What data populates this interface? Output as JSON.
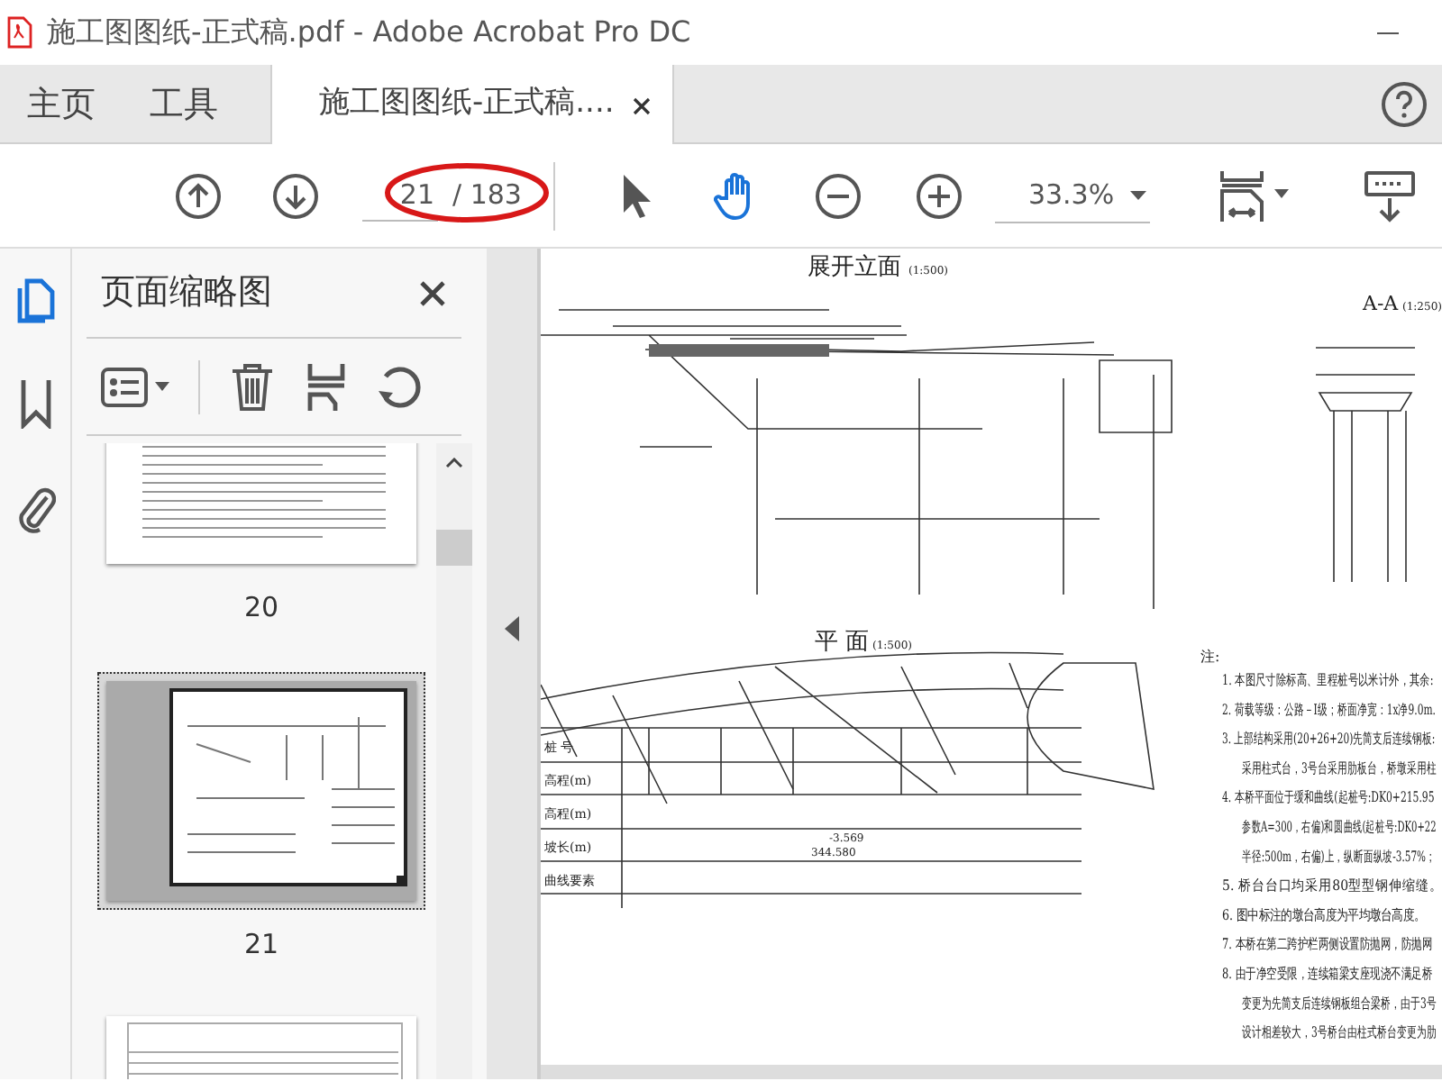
{
  "window": {
    "title": "施工图图纸-正式稿.pdf - Adobe Acrobat Pro DC"
  },
  "tabs": [
    {
      "label": "主页",
      "selected": false,
      "closable": false
    },
    {
      "label": "工具",
      "selected": false,
      "closable": false
    },
    {
      "label": "施工图图纸-正式稿....",
      "selected": true,
      "closable": true
    }
  ],
  "toolbar": {
    "page_input": "21",
    "page_total": "/ 183",
    "zoom": "33.3%",
    "tools": [
      {
        "kind": "select",
        "selected": false
      },
      {
        "kind": "hand",
        "selected": true
      }
    ]
  },
  "sidebar": {
    "items": [
      {
        "kind": "pages",
        "selected": true
      },
      {
        "kind": "bookmarks",
        "selected": false
      },
      {
        "kind": "attachments",
        "selected": false
      }
    ]
  },
  "thumbnail_panel": {
    "title": "页面缩略图",
    "thumbnails": [
      {
        "kind": "text",
        "page": "20",
        "selected": false
      },
      {
        "kind": "drawing",
        "page": "21",
        "selected": true
      },
      {
        "kind": "table",
        "selected": false
      }
    ]
  },
  "document": {
    "elevation_title": "展开立面",
    "elevation_scale": "(1:500)",
    "section_title": "A-A",
    "section_scale": "(1:250)",
    "plan_title": "平  面",
    "plan_scale": "(1:500)",
    "notes_title": "注:",
    "notes": [
      "1. 本图尺寸除标高、里程桩号以米计外，其余:",
      "2. 荷载等级：公路－Ⅰ级；桥面净宽：1x净9.0m.",
      "3. 上部结构采用(20+26+20)先简支后连续钢板:",
      "采用柱式台，3号台采用肋板台，桥墩采用柱",
      "4. 本桥平面位于缓和曲线(起桩号:DK0+215.95",
      "参数A=300，右偏)和圆曲线(起桩号:DK0+22",
      "半径:500m，右偏)上，纵断面纵坡-3.57%；",
      "5. 桥台台口均采用80型型钢伸缩缝。",
      "6. 图中标注的墩台高度为平均墩台高度。",
      "7. 本桥在第二跨护栏两侧设置防抛网，防抛网",
      "8. 由于净空受限，连续箱梁支座现浇不满足桥",
      "变更为先简支后连续钢板组合梁桥，由于3号",
      "设计相差较大，3号桥台由柱式桥台变更为肋"
    ],
    "table_rows": [
      "桩 号",
      "高程(m)",
      "高程(m)",
      "坡长(m)",
      "曲线要素"
    ],
    "table_values": [
      "-3.569",
      "344.580"
    ]
  }
}
